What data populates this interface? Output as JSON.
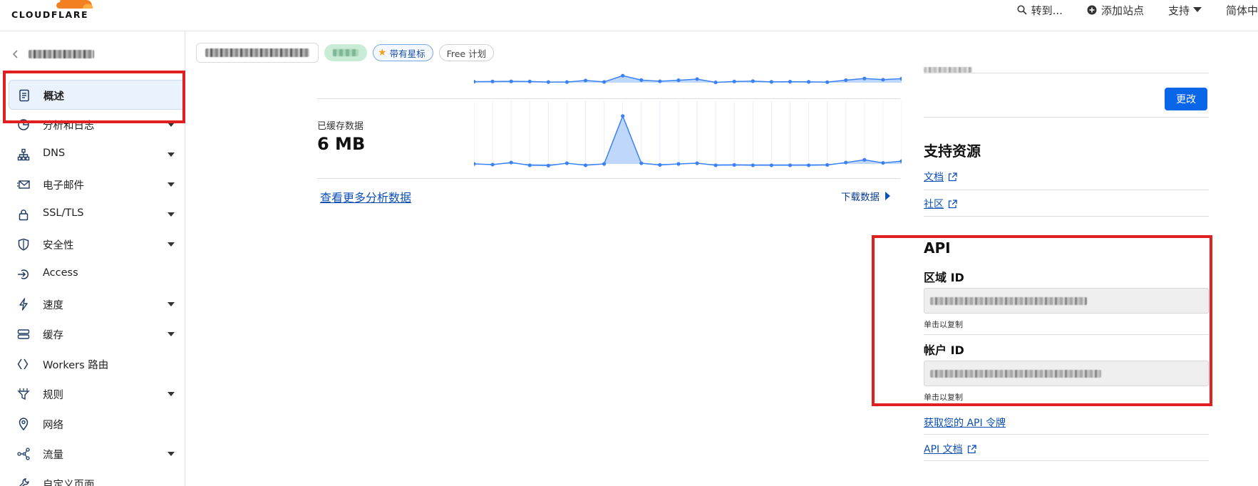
{
  "header": {
    "logo_text": "CLOUDFLARE",
    "goto_label": "转到...",
    "add_site_label": "添加站点",
    "support_label": "支持",
    "language_label": "简体中"
  },
  "sidebar": {
    "items": [
      {
        "label": "概述",
        "icon": "document-icon",
        "has_caret": false,
        "active": true
      },
      {
        "label": "分析和日志",
        "icon": "pie-chart-icon",
        "has_caret": true
      },
      {
        "label": "DNS",
        "icon": "sitemap-icon",
        "has_caret": true
      },
      {
        "label": "电子邮件",
        "icon": "email-icon",
        "has_caret": true
      },
      {
        "label": "SSL/TLS",
        "icon": "lock-icon",
        "has_caret": true
      },
      {
        "label": "安全性",
        "icon": "shield-icon",
        "has_caret": true
      },
      {
        "label": "Access",
        "icon": "access-icon",
        "has_caret": false
      },
      {
        "label": "速度",
        "icon": "lightning-icon",
        "has_caret": true
      },
      {
        "label": "缓存",
        "icon": "storage-icon",
        "has_caret": true
      },
      {
        "label": "Workers 路由",
        "icon": "code-icon",
        "has_caret": false
      },
      {
        "label": "规则",
        "icon": "filter-icon",
        "has_caret": true
      },
      {
        "label": "网络",
        "icon": "location-icon",
        "has_caret": false
      },
      {
        "label": "流量",
        "icon": "traffic-icon",
        "has_caret": true
      },
      {
        "label": "自定义页面",
        "icon": "wrench-icon",
        "has_caret": false
      }
    ]
  },
  "zone": {
    "star_label": "带有星标",
    "plan_label": "Free 计划"
  },
  "analytics": {
    "cached_label": "已缓存数据",
    "cached_value": "6 MB",
    "more_link": "查看更多分析数据",
    "download_label": "下载数据"
  },
  "right": {
    "change_button": "更改",
    "support_title": "支持资源",
    "docs_link": "文档",
    "community_link": "社区",
    "api_title": "API",
    "zone_id_label": "区域 ID",
    "zone_id_hint": "单击以复制",
    "account_id_label": "帐户 ID",
    "account_id_hint": "单击以复制",
    "api_token_link": "获取您的 API 令牌",
    "api_docs_link": "API 文档"
  },
  "colors": {
    "accent": "#0a66e8",
    "chart_line": "#3b82f6",
    "chart_fill": "#bfd7fb",
    "highlight_red": "#e02020",
    "cloudflare_orange": "#f38020"
  }
}
